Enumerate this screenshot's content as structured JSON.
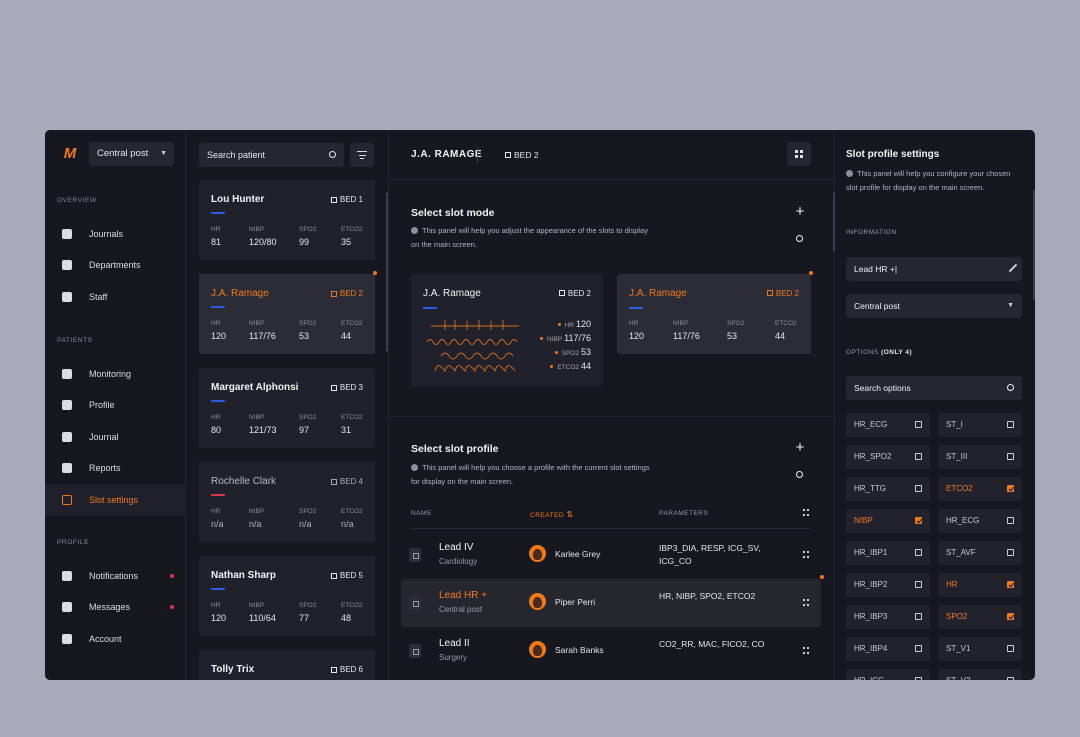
{
  "nav": {
    "logo": "M",
    "post_select": "Central post",
    "sections": {
      "overview": "OVERVIEW",
      "patients": "PATIENTS",
      "profile": "PROFILE"
    },
    "overview_items": [
      {
        "label": "Journals",
        "icon": "journal-icon"
      },
      {
        "label": "Departments",
        "icon": "home-icon"
      },
      {
        "label": "Staff",
        "icon": "people-icon"
      }
    ],
    "patient_items": [
      {
        "label": "Monitoring",
        "icon": "monitoring-icon"
      },
      {
        "label": "Profile",
        "icon": "grid-icon"
      },
      {
        "label": "Journal",
        "icon": "list-icon"
      },
      {
        "label": "Reports",
        "icon": "chart-icon"
      },
      {
        "label": "Slot settings",
        "icon": "slot-icon",
        "active": true
      }
    ],
    "profile_items": [
      {
        "label": "Notifications",
        "icon": "bell-icon",
        "dot": true
      },
      {
        "label": "Messages",
        "icon": "chat-icon",
        "dot": true
      },
      {
        "label": "Account",
        "icon": "account-icon"
      }
    ]
  },
  "patients": {
    "search_placeholder": "Search patient",
    "labels": [
      "HR",
      "NIBP",
      "SPO2",
      "ETCO2"
    ],
    "list": [
      {
        "name": "Lou Hunter",
        "bed": "BED 1",
        "values": [
          "81",
          "120/80",
          "99",
          "35"
        ]
      },
      {
        "name": "J.A. Ramage",
        "bed": "BED 2",
        "values": [
          "120",
          "117/76",
          "53",
          "44"
        ],
        "selected": true
      },
      {
        "name": "Margaret Alphonsi",
        "bed": "BED 3",
        "values": [
          "80",
          "121/73",
          "97",
          "31"
        ]
      },
      {
        "name": "Rochelle Clark",
        "bed": "BED 4",
        "values": [
          "n/a",
          "n/a",
          "n/a",
          "n/a"
        ],
        "dim": true
      },
      {
        "name": "Nathan Sharp",
        "bed": "BED 5",
        "values": [
          "120",
          "110/64",
          "77",
          "48"
        ]
      },
      {
        "name": "Tolly Trix",
        "bed": "BED 6",
        "values": [
          "",
          "",
          "",
          ""
        ]
      }
    ]
  },
  "main": {
    "patient_name": "J.A. RAMAGE",
    "bed": "BED 2",
    "slot_mode": {
      "title": "Select slot mode",
      "desc": "This panel will help you adjust the appearance of the slots to display on the main screen.",
      "card_wave": {
        "name": "J.A. Ramage",
        "bed": "BED 2",
        "readouts": [
          {
            "label": "HR",
            "value": "120"
          },
          {
            "label": "NIBP",
            "value": "117/76"
          },
          {
            "label": "SPO2",
            "value": "53"
          },
          {
            "label": "ETCO2",
            "value": "44"
          }
        ]
      },
      "card_values": {
        "name": "J.A. Ramage",
        "bed": "BED 2",
        "labels": [
          "HR",
          "NIBP",
          "SPO2",
          "ETCO2"
        ],
        "values": [
          "120",
          "117/76",
          "53",
          "44"
        ]
      }
    },
    "slot_profile": {
      "title": "Select slot profile",
      "desc": "This panel will help you choose a profile with the current slot settings for display on the main screen.",
      "columns": {
        "name": "NAME",
        "created": "CREATED",
        "parameters": "PARAMETERS"
      },
      "rows": [
        {
          "name": "Lead IV",
          "dept": "Cardiology",
          "user": "Karlee Grey",
          "params": "IBP3_DIA, RESP, ICG_SV, ICG_CO"
        },
        {
          "name": "Lead HR +",
          "dept": "Central post",
          "user": "Piper Perri",
          "params": "HR, NIBP, SPO2, ETCO2",
          "selected": true
        },
        {
          "name": "Lead II",
          "dept": "Surgery",
          "user": "Sarah Banks",
          "params": "CO2_RR, MAC, FICO2, CO"
        }
      ]
    }
  },
  "right": {
    "title": "Slot profile settings",
    "desc": "This panel will help you configure your chosen slot profile for display on the main screen.",
    "info_label": "INFORMATION",
    "profile_name": "Lead HR +|",
    "post": "Central post",
    "options_label": "OPTIONS",
    "options_note": "(ONLY 4)",
    "search_placeholder": "Search options",
    "options": [
      {
        "label": "HR_ECG",
        "on": false
      },
      {
        "label": "ST_I",
        "on": false
      },
      {
        "label": "HR_SPO2",
        "on": false
      },
      {
        "label": "ST_III",
        "on": false
      },
      {
        "label": "HR_TTG",
        "on": false
      },
      {
        "label": "ETCO2",
        "on": true
      },
      {
        "label": "NIBP",
        "on": true
      },
      {
        "label": "HR_ECG",
        "on": false
      },
      {
        "label": "HR_IBP1",
        "on": false
      },
      {
        "label": "ST_AVF",
        "on": false
      },
      {
        "label": "HR_IBP2",
        "on": false
      },
      {
        "label": "HR",
        "on": true
      },
      {
        "label": "HR_IBP3",
        "on": false
      },
      {
        "label": "SPO2",
        "on": true
      },
      {
        "label": "HR_IBP4",
        "on": false
      },
      {
        "label": "ST_V1",
        "on": false
      },
      {
        "label": "HR_ICG",
        "on": false
      },
      {
        "label": "ST_V2",
        "on": false
      }
    ]
  },
  "colors": {
    "accent": "#f07a1a",
    "blue": "#2f5bea",
    "red": "#e0334d",
    "panel": "#17171f"
  }
}
